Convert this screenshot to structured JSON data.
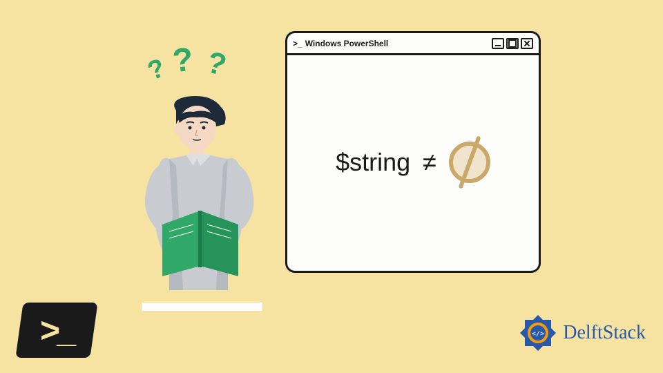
{
  "window": {
    "prompt": ">_",
    "title": "Windows PowerShell"
  },
  "expression": {
    "variable": "$string",
    "operator": "≠"
  },
  "brand": {
    "name": "DelftStack"
  },
  "icons": {
    "powershell": "powershell-icon",
    "empty_set": "empty-set-icon",
    "question": "question-mark-icon"
  },
  "colors": {
    "background": "#f7e3a1",
    "accent_green": "#2fa868",
    "brand_blue": "#2858a8",
    "window_bg": "#fdfdfb",
    "border": "#1a1a1a"
  }
}
